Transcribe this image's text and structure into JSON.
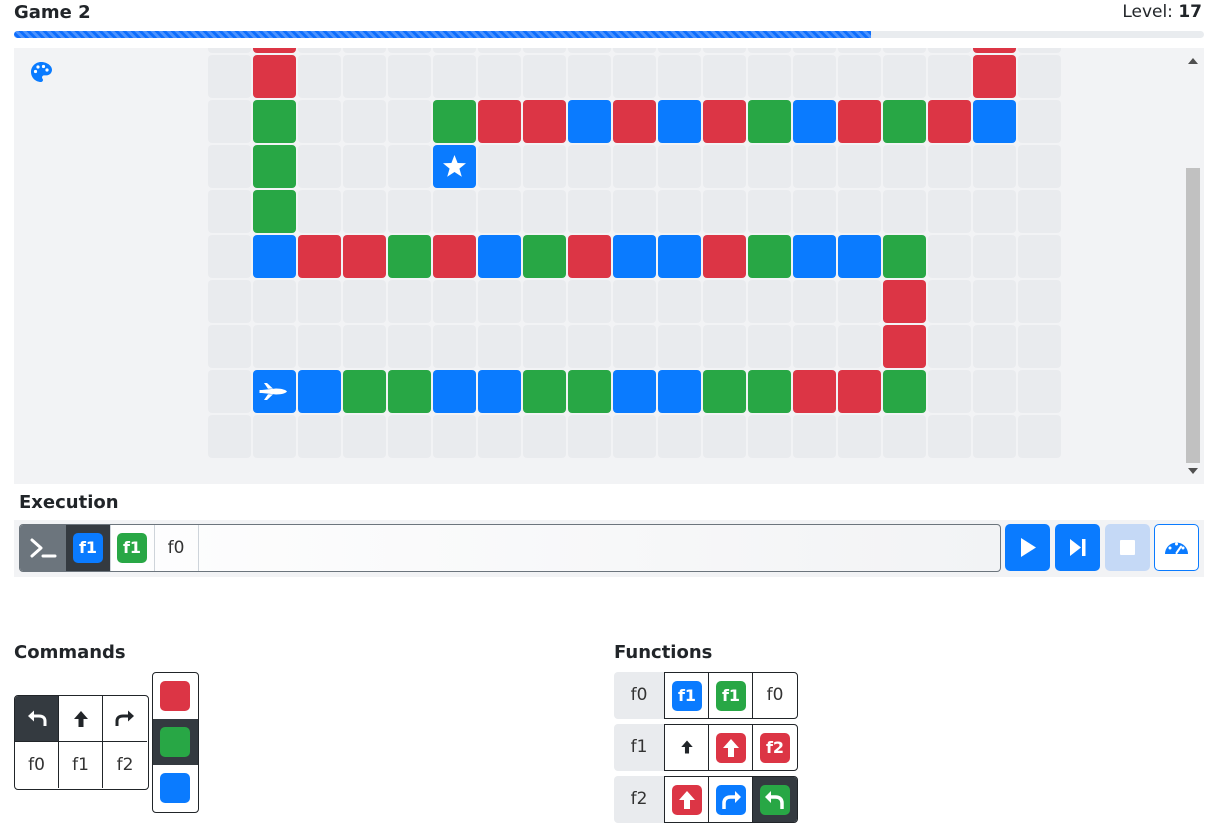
{
  "header": {
    "title": "Game 2",
    "level_label": "Level:",
    "level_value": "17",
    "progress": 0.72
  },
  "board": {
    "rows": [
      ".R...............R.",
      ".R...............R.",
      ".G...GRRBRBRGBRGRB.",
      ".G...S.............",
      ".G.................",
      ".BRRGRBGRBBRGBBG...",
      "...............R...",
      "...............R...",
      ".PBGGBBGGBBGGRRG...",
      "..................."
    ],
    "legend": {
      "R": "red",
      "G": "green",
      "B": "blue",
      "S": "star on blue",
      "P": "ship on blue",
      ".": "empty"
    },
    "colors": {
      "red": "#dc3545",
      "green": "#28a745",
      "blue": "#0a7bff",
      "empty": "#e9ebee"
    }
  },
  "execution": {
    "label": "Execution",
    "queue": [
      {
        "text": "f1",
        "color": "blue",
        "active": true
      },
      {
        "text": "f1",
        "color": "green",
        "active": false
      },
      {
        "text": "f0",
        "color": "none",
        "active": false
      }
    ],
    "controls": [
      "play-icon",
      "step-icon",
      "stop-icon",
      "speed-icon"
    ]
  },
  "commands": {
    "label": "Commands",
    "moves": [
      "turn-left-icon",
      "forward-icon",
      "turn-right-icon"
    ],
    "functions": [
      "f0",
      "f1",
      "f2"
    ],
    "colors": [
      "red",
      "green",
      "blue"
    ]
  },
  "functions": {
    "label": "Functions",
    "rows": [
      {
        "name": "f0",
        "slots": [
          {
            "type": "call",
            "text": "f1",
            "color": "blue"
          },
          {
            "type": "call",
            "text": "f1",
            "color": "green"
          },
          {
            "type": "call",
            "text": "f0",
            "color": "none"
          }
        ]
      },
      {
        "name": "f1",
        "slots": [
          {
            "type": "move",
            "icon": "forward-icon",
            "color": "none"
          },
          {
            "type": "move",
            "icon": "forward-icon",
            "color": "red"
          },
          {
            "type": "call",
            "text": "f2",
            "color": "red"
          }
        ]
      },
      {
        "name": "f2",
        "slots": [
          {
            "type": "move",
            "icon": "forward-icon",
            "color": "red"
          },
          {
            "type": "move",
            "icon": "turn-right-icon",
            "color": "blue"
          },
          {
            "type": "move",
            "icon": "turn-left-icon",
            "color": "green"
          }
        ]
      }
    ]
  }
}
